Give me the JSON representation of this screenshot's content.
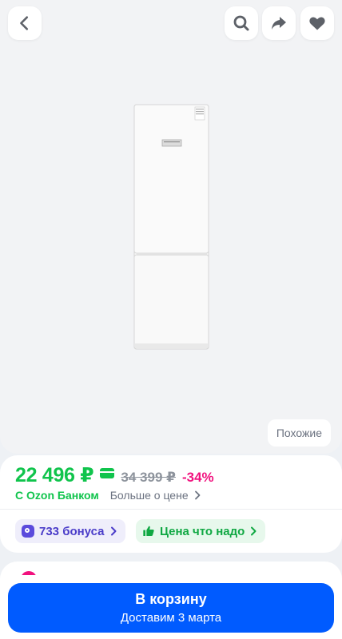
{
  "header": {
    "back_icon": "chevron-left-icon",
    "search_icon": "search-icon",
    "share_icon": "share-icon",
    "favorite_icon": "heart-icon"
  },
  "gallery": {
    "image": "white-two-door-refrigerator",
    "similar_label": "Похожие"
  },
  "price": {
    "current": "22 496 ₽",
    "old": "34 399 ₽",
    "discount": "-34%",
    "bank_label": "С Ozon Банком",
    "more_label": "Больше о цене"
  },
  "chips": {
    "bonus_label": "733 бонуса",
    "price_label": "Цена что надо"
  },
  "cart": {
    "title": "В корзину",
    "subtitle": "Доставим 3 марта"
  },
  "colors": {
    "accent_blue": "#005bff",
    "price_green": "#10c44c",
    "discount_pink": "#f1117e",
    "bonus_purple": "#4a3cc9"
  }
}
